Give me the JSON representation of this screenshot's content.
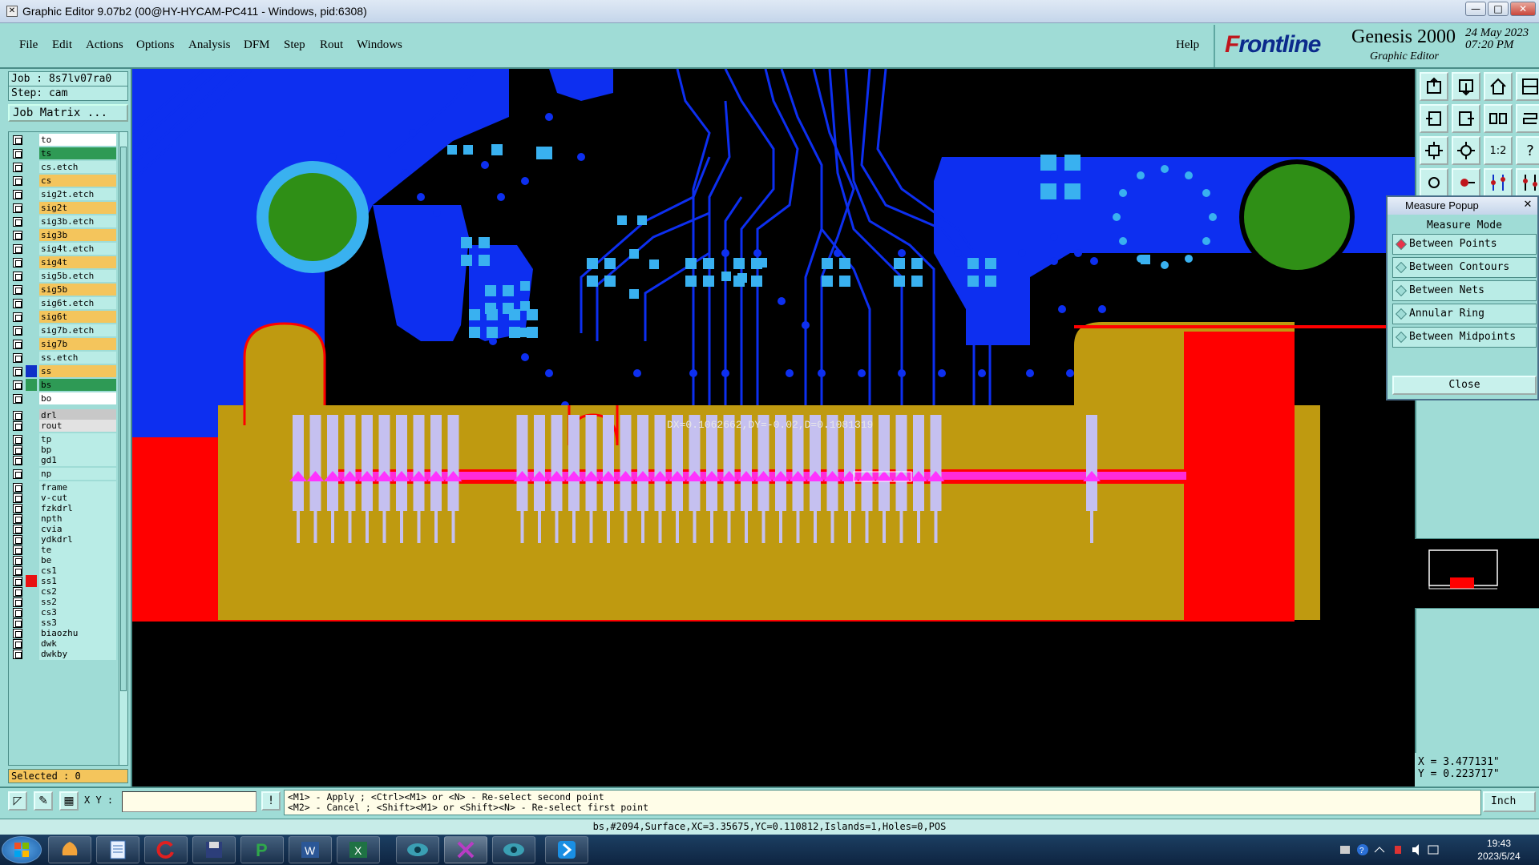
{
  "window": {
    "title": "Graphic Editor 9.07b2 (00@HY-HYCAM-PC411 - Windows, pid:6308)",
    "minimize": "—",
    "maximize": "□",
    "close": "✕"
  },
  "menu": {
    "file": "File",
    "edit": "Edit",
    "actions": "Actions",
    "options": "Options",
    "analysis": "Analysis",
    "dfm": "DFM",
    "step": "Step",
    "rout": "Rout",
    "windows": "Windows",
    "help": "Help"
  },
  "logo": {
    "brand_prefix": "F",
    "brand_rest": "rontline",
    "product": "Genesis 2000",
    "subtitle": "Graphic Editor",
    "date": "24 May 2023",
    "time": "07:20 PM"
  },
  "job": {
    "job": "Job : 8s7lv07ra0",
    "step": "Step: cam",
    "matrix_button": "Job Matrix ..."
  },
  "layers": [
    {
      "name": "to",
      "color": "#ffffff",
      "swatch": ""
    },
    {
      "name": "ts",
      "color": "#2e9a55",
      "swatch": ""
    },
    {
      "name": "cs.etch",
      "color": "#b9ece6",
      "swatch": ""
    },
    {
      "name": "cs",
      "color": "#f4c55c",
      "swatch": ""
    },
    {
      "name": "sig2t.etch",
      "color": "#b9ece6",
      "swatch": ""
    },
    {
      "name": "sig2t",
      "color": "#f4c55c",
      "swatch": ""
    },
    {
      "name": "sig3b.etch",
      "color": "#b9ece6",
      "swatch": ""
    },
    {
      "name": "sig3b",
      "color": "#f4c55c",
      "swatch": ""
    },
    {
      "name": "sig4t.etch",
      "color": "#b9ece6",
      "swatch": ""
    },
    {
      "name": "sig4t",
      "color": "#f4c55c",
      "swatch": ""
    },
    {
      "name": "sig5b.etch",
      "color": "#b9ece6",
      "swatch": ""
    },
    {
      "name": "sig5b",
      "color": "#f4c55c",
      "swatch": ""
    },
    {
      "name": "sig6t.etch",
      "color": "#b9ece6",
      "swatch": ""
    },
    {
      "name": "sig6t",
      "color": "#f4c55c",
      "swatch": ""
    },
    {
      "name": "sig7b.etch",
      "color": "#b9ece6",
      "swatch": ""
    },
    {
      "name": "sig7b",
      "color": "#f4c55c",
      "swatch": ""
    },
    {
      "name": "ss.etch",
      "color": "#b9ece6",
      "swatch": ""
    },
    {
      "name": "ss",
      "color": "#f4c55c",
      "swatch": "#1030c8"
    },
    {
      "name": "bs",
      "color": "#2e9a55",
      "swatch": "#2e9a55"
    },
    {
      "name": "bo",
      "color": "#ffffff",
      "swatch": ""
    },
    {
      "name": "drl",
      "color": "#c8c8c8",
      "swatch": ""
    },
    {
      "name": "rout",
      "color": "#e2e2e2",
      "swatch": ""
    },
    {
      "name": "tp",
      "color": "#b9ece6",
      "swatch": ""
    },
    {
      "name": "bp",
      "color": "#b9ece6",
      "swatch": ""
    },
    {
      "name": "gd1",
      "color": "#b9ece6",
      "swatch": ""
    },
    {
      "name": "np",
      "color": "#b9ece6",
      "swatch": ""
    },
    {
      "name": "frame",
      "color": "#b9ece6",
      "swatch": ""
    },
    {
      "name": "v-cut",
      "color": "#b9ece6",
      "swatch": ""
    },
    {
      "name": "fzkdrl",
      "color": "#b9ece6",
      "swatch": ""
    },
    {
      "name": "npth",
      "color": "#b9ece6",
      "swatch": ""
    },
    {
      "name": "cvia",
      "color": "#b9ece6",
      "swatch": ""
    },
    {
      "name": "ydkdrl",
      "color": "#b9ece6",
      "swatch": ""
    },
    {
      "name": "te",
      "color": "#b9ece6",
      "swatch": ""
    },
    {
      "name": "be",
      "color": "#b9ece6",
      "swatch": ""
    },
    {
      "name": "cs1",
      "color": "#b9ece6",
      "swatch": ""
    },
    {
      "name": "ss1",
      "color": "#b9ece6",
      "swatch": "#e81010"
    },
    {
      "name": "cs2",
      "color": "#b9ece6",
      "swatch": ""
    },
    {
      "name": "ss2",
      "color": "#b9ece6",
      "swatch": ""
    },
    {
      "name": "cs3",
      "color": "#b9ece6",
      "swatch": ""
    },
    {
      "name": "ss3",
      "color": "#b9ece6",
      "swatch": ""
    },
    {
      "name": "biaozhu",
      "color": "#b9ece6",
      "swatch": ""
    },
    {
      "name": "dwk",
      "color": "#b9ece6",
      "swatch": ""
    },
    {
      "name": "dwkby",
      "color": "#b9ece6",
      "swatch": ""
    }
  ],
  "selected": "Selected : 0",
  "measure_text": "DX=0.1062662,DY=-0.02,D=0.1081319",
  "popup": {
    "title": "Measure Popup",
    "close_x": "✕",
    "mode_label": "Measure Mode",
    "options": [
      "Between Points",
      "Between Contours",
      "Between Nets",
      "Annular Ring",
      "Between Midpoints"
    ],
    "selected_index": 0,
    "close_button": "Close"
  },
  "coords": {
    "x": "X = 3.477131\"",
    "y": "Y = 0.223717\""
  },
  "bottom": {
    "xy_label": "X Y :",
    "xy_value": "",
    "hint_line1": "<M1> - Apply  ; <Ctrl><M1> or <N> - Re-select second point",
    "hint_line2": "<M2> - Cancel ; <Shift><M1> or <Shift><N> - Re-select first point",
    "units": "Inch"
  },
  "status": "bs,#2094,Surface,XC=3.35675,YC=0.110812,Islands=1,Holes=0,POS",
  "taskbar": {
    "time": "19:43",
    "date": "2023/5/24",
    "icons": [
      "start-orb-icon",
      "shell-icon",
      "notepad-icon",
      "refresh-app-icon",
      "save-disk-icon",
      "green-p-icon",
      "word-icon",
      "excel-icon",
      "eye-app-icon",
      "genesis-x-icon",
      "eye-app2-icon",
      "arrow-app-icon"
    ]
  },
  "colors": {
    "panel": "#9fdcd6",
    "copper_blue": "#0d2ff0",
    "gold": "#bf9a10",
    "pad": "#c5c0f0",
    "red": "#ff0000",
    "green": "#2f8f16"
  }
}
